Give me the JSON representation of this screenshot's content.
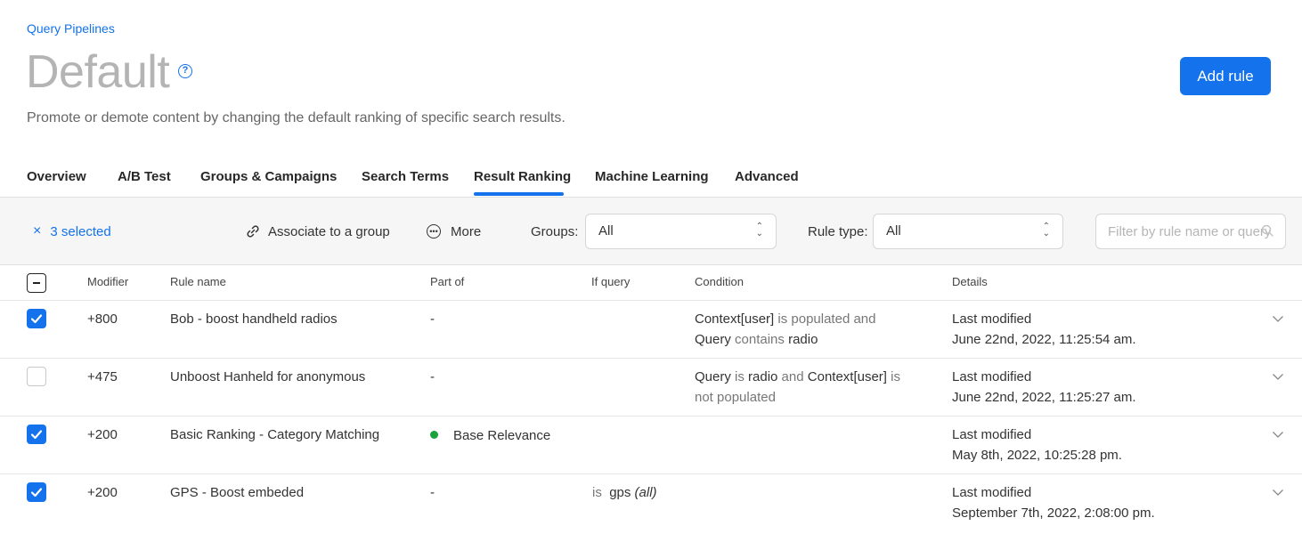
{
  "breadcrumb": "Query Pipelines",
  "page": {
    "title": "Default",
    "help_icon": "?",
    "subtitle": "Promote or demote content by changing the default ranking of specific search results."
  },
  "add_rule_label": "Add rule",
  "tabs": [
    {
      "label": "Overview"
    },
    {
      "label": "A/B Test"
    },
    {
      "label": "Groups & Campaigns"
    },
    {
      "label": "Search Terms"
    },
    {
      "label": "Result Ranking",
      "active": true
    },
    {
      "label": "Machine Learning"
    },
    {
      "label": "Advanced"
    }
  ],
  "toolbar": {
    "clear_icon": "×",
    "selected_label": "3 selected",
    "associate_label": "Associate to a group",
    "more_label": "More",
    "groups_label": "Groups:",
    "groups_value": "All",
    "rule_type_label": "Rule type:",
    "rule_type_value": "All",
    "filter_placeholder": "Filter by rule name or query"
  },
  "table": {
    "headers": {
      "modifier": "Modifier",
      "rule_name": "Rule name",
      "part_of": "Part of",
      "if_query": "If query",
      "condition": "Condition",
      "details": "Details"
    },
    "rows": [
      {
        "checked": true,
        "modifier": "+800",
        "rule_name": "Bob - boost handheld radios",
        "part_of": "-",
        "if_query_op": "",
        "if_query_value": "",
        "if_query_qualifier": "",
        "condition": {
          "l1a": "Context[user]",
          "l1b": " is populated and",
          "l2a": "Query",
          "l2b": " contains ",
          "l2c": "radio"
        },
        "details_label": "Last modified",
        "details_date": "June 22nd, 2022, 11:25:54 am."
      },
      {
        "checked": false,
        "modifier": "+475",
        "rule_name": "Unboost Hanheld for anonymous",
        "part_of": "-",
        "if_query_op": "",
        "if_query_value": "",
        "if_query_qualifier": "",
        "condition": {
          "l1a": "Query",
          "l1b": " is ",
          "l1c": "radio",
          "l1d": " and ",
          "l1e": "Context[user]",
          "l1f": " is",
          "l2a": "not populated"
        },
        "details_label": "Last modified",
        "details_date": "June 22nd, 2022, 11:25:27 am."
      },
      {
        "checked": true,
        "modifier": "+200",
        "rule_name": "Basic Ranking - Category Matching",
        "part_of": "Base Relevance",
        "part_of_status_color": "#1aa33d",
        "if_query_op": "",
        "if_query_value": "",
        "if_query_qualifier": "",
        "details_label": "Last modified",
        "details_date": "May 8th, 2022, 10:25:28 pm."
      },
      {
        "checked": true,
        "modifier": "+200",
        "rule_name": "GPS - Boost embeded",
        "part_of": "-",
        "if_query_op": "is",
        "if_query_value": "gps",
        "if_query_qualifier": "(all)",
        "details_label": "Last modified",
        "details_date": "September 7th, 2022, 2:08:00 pm."
      }
    ]
  },
  "colors": {
    "accent": "#1372ec",
    "status_green": "#1aa33d",
    "title_gray": "#b4b4b4"
  },
  "icons": [
    "help-icon",
    "close-icon",
    "link-icon",
    "more-icon",
    "select-arrows-icon",
    "search-icon",
    "checkbox-icon",
    "chevron-down-icon"
  ]
}
